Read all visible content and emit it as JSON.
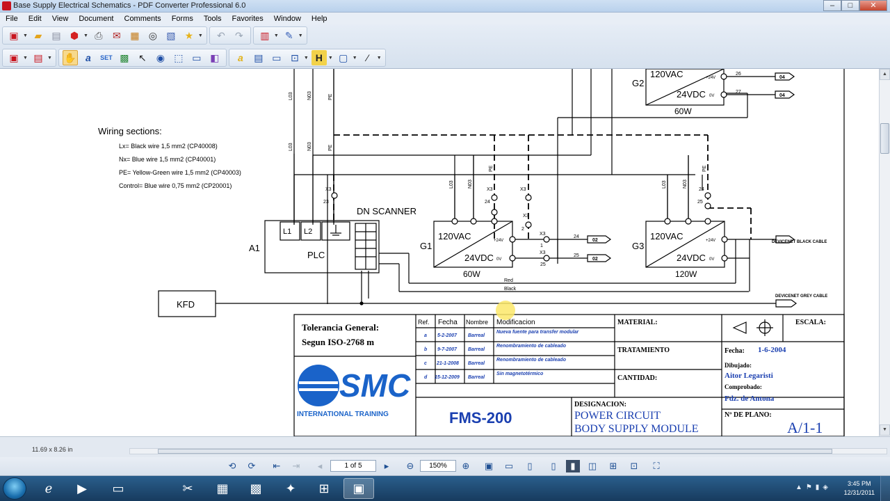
{
  "window": {
    "title": "Base Supply Electrical Schematics - PDF Converter Professional 6.0",
    "controls": {
      "minimize": "–",
      "maximize": "□",
      "close": "✕"
    }
  },
  "menu": [
    "File",
    "Edit",
    "View",
    "Document",
    "Comments",
    "Forms",
    "Tools",
    "Favorites",
    "Window",
    "Help"
  ],
  "toolbar_icons": {
    "row1": [
      "pdf-create-icon",
      "open-icon",
      "save-icon",
      "convert-icon",
      "print-icon",
      "email-icon",
      "package-icon",
      "find-icon",
      "favorite-icon",
      "star-icon",
      "undo-icon",
      "redo-icon",
      "properties-icon",
      "pen-icon"
    ],
    "row2": [
      "pdf-create-icon",
      "document-icon",
      "hand-tool-icon",
      "text-select-icon",
      "set-icon",
      "image-icon",
      "select-icon",
      "snapshot-icon",
      "crop-icon",
      "fit-icon",
      "shape-icon",
      "highlight-icon",
      "note-icon",
      "comment-icon",
      "stamp-icon",
      "header-icon",
      "textbox-icon",
      "pencil-icon"
    ]
  },
  "schematic": {
    "wiring_sections": {
      "title": "Wiring sections:",
      "lines": [
        "Lx= Black wire 1,5 mm2 (CP40008)",
        "Nx= Blue wire 1,5 mm2 (CP40001)",
        "PE= Yellow-Green wire 1,5 mm2 (CP40003)",
        "Control= Blue wire 0,75 mm2 (CP20001)"
      ]
    },
    "vertical_labels": [
      "L03",
      "N03",
      "PE",
      "L03",
      "N03",
      "PE",
      "L03",
      "N03",
      "PE",
      "L03",
      "N03",
      "PE"
    ],
    "plc": {
      "ref": "A1",
      "label": "PLC",
      "terminals": [
        "L1",
        "L2"
      ]
    },
    "dn_scanner": "DN SCANNER",
    "kfd": "KFD",
    "power_supplies": [
      {
        "ref": "G1",
        "in": "120VAC",
        "out": "24VDC",
        "plus": "+24V",
        "zero": "0V",
        "watts": "60W"
      },
      {
        "ref": "G2",
        "in": "120VAC",
        "out": "24VDC",
        "plus": "+24V",
        "zero": "0V",
        "watts": "60W"
      },
      {
        "ref": "G3",
        "in": "120VAC",
        "out": "24VDC",
        "plus": "+24V",
        "zero": "0V",
        "watts": "120W"
      }
    ],
    "terminals": [
      "X3",
      "23",
      "X3",
      "24",
      "X3",
      "2",
      "X3",
      "7",
      "X3",
      "1",
      "X3",
      "25",
      "24",
      "25",
      "26",
      "27"
    ],
    "outputs": [
      "02",
      "02",
      "04",
      "04"
    ],
    "wire_labels": {
      "red": "Red",
      "black": "Black"
    },
    "cable_labels": [
      "DEVICENET BLACK CABLE",
      "DEVICENET GREY CABLE"
    ],
    "title_block": {
      "tolerance": [
        "Tolerancia General:",
        "Segun ISO-2768 m"
      ],
      "headers": [
        "Ref.",
        "Fecha",
        "Nombre",
        "Modificacion"
      ],
      "revisions": [
        {
          "ref": "a",
          "fecha": "5-2-2007",
          "nombre": "Barreal",
          "mod": "Nueva fuente para transfer modular"
        },
        {
          "ref": "b",
          "fecha": "9-7-2007",
          "nombre": "Barreal",
          "mod": "Renombramiento de cableado"
        },
        {
          "ref": "c",
          "fecha": "21-1-2008",
          "nombre": "Barreal",
          "mod": "Renombramiento de cableado"
        },
        {
          "ref": "d",
          "fecha": "15-12-2009",
          "nombre": "Barreal",
          "mod": "Sin magnetotérmico"
        }
      ],
      "material": "MATERIAL:",
      "tratamiento": "TRATAMIENTO",
      "cantidad": "CANTIDAD:",
      "escala": "ESCALA:",
      "fecha_label": "Fecha:",
      "fecha_value": "1-6-2004",
      "dibujado_label": "Dibujado:",
      "dibujado_value": "Aitor Legaristi",
      "comprobado_label": "Comprobado:",
      "comprobado_value": "Fdz. de Antona",
      "designacion_label": "DESIGNACION:",
      "designacion_lines": [
        "POWER CIRCUIT",
        "BODY SUPPLY MODULE"
      ],
      "plano_label": "Nº DE PLANO:",
      "plano_value": "A/1-1",
      "fms": "FMS-200",
      "logo": "SMC",
      "logo_sub": "INTERNATIONAL TRAINING"
    }
  },
  "status": {
    "page_size": "11.69 x 8.26 in"
  },
  "navigation": {
    "page": "1 of 5",
    "zoom": "150%"
  },
  "taskbar": {
    "time": "3:45 PM",
    "date": "12/31/2011"
  },
  "colors": {
    "accent": "#1a5ec8",
    "smc_blue": "#1a63c9",
    "taskbar": "#1f4a73"
  }
}
